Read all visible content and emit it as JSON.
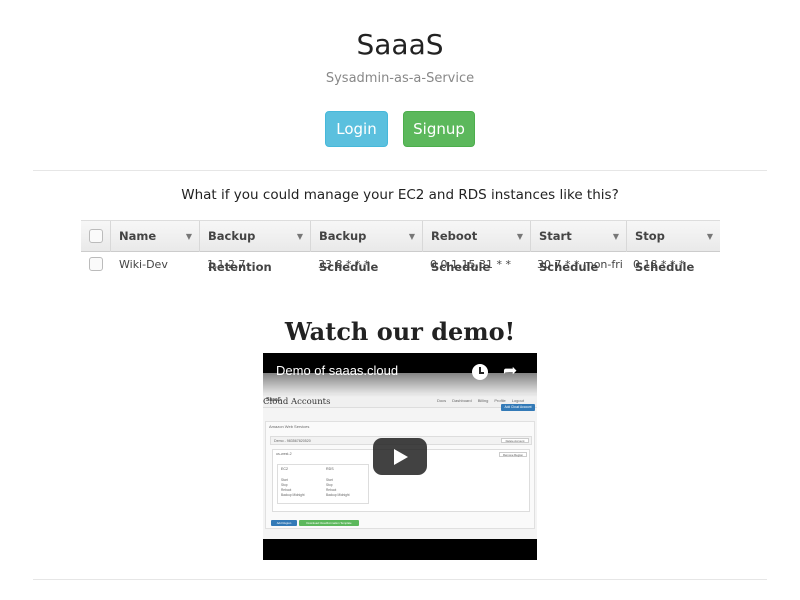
{
  "header": {
    "title": "SaaaS",
    "subtitle": "Sysadmin-as-a-Service",
    "login_label": "Login",
    "signup_label": "Signup"
  },
  "pitch": {
    "text": "What if you could manage your EC2 and RDS instances like this?"
  },
  "grid": {
    "columns": [
      "Name",
      "Backup Retention",
      "Backup Schedule",
      "Reboot Schedule",
      "Start Schedule",
      "Stop Schedule"
    ],
    "rows": [
      {
        "name": "Wiki-Dev",
        "backup_retention": "1,1,2,7",
        "backup_schedule": "33 8 * * *",
        "reboot_schedule": "0 0 1,15,31 * *",
        "start_schedule": "30 7 * * mon-fri",
        "stop_schedule": "0 18 * * *"
      }
    ]
  },
  "demo": {
    "heading": "Watch our demo!",
    "video_title": "Demo of saaas.cloud",
    "inner": {
      "brand": "SaaaS",
      "nav": [
        "Docs",
        "Dashboard",
        "Billing",
        "Profile",
        "Logout"
      ],
      "heading": "Cloud Accounts",
      "add_button": "Add Cloud Account",
      "panel_head": "Amazon Web Services",
      "account_label": "Demo - 983567820520",
      "delete_button": "Delete Account",
      "region_label": "us-west-2",
      "remove_region_button": "Remove Region",
      "ec2_label": "EC2",
      "rds_label": "RDS",
      "ec2_options": [
        "Start",
        "Stop",
        "Reboot",
        "Backup Midnight"
      ],
      "rds_options": [
        "Start",
        "Stop",
        "Reboot",
        "Backup Midnight"
      ],
      "add_region_button": "Add Region",
      "download_button": "Download CloudFormation Template"
    }
  }
}
